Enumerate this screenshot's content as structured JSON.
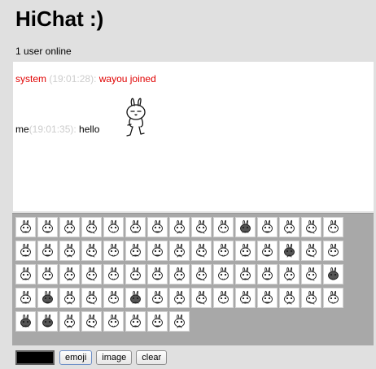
{
  "app": {
    "title": "HiChat :)"
  },
  "status": {
    "online_text": "1 user online"
  },
  "messages": [
    {
      "sender": "system",
      "time": "(19:01:28): ",
      "text": "wayou joined",
      "color": "#e00000"
    },
    {
      "sender": "me",
      "time": "(19:01:35): ",
      "text": "hello",
      "sticker": "rabbit-sticker"
    }
  ],
  "emoji_panel": {
    "count": 68,
    "sprite": "onion-rabbit-emoji-set"
  },
  "controls": {
    "color_value": "#000000",
    "emoji_label": "emoji",
    "image_label": "image",
    "clear_label": "clear"
  },
  "colors": {
    "background": "#e0e0e0",
    "messages_bg": "#ffffff",
    "system_text": "#e00000",
    "timestamp": "#cccccc",
    "emoji_panel_bg": "#a8a8a8"
  }
}
